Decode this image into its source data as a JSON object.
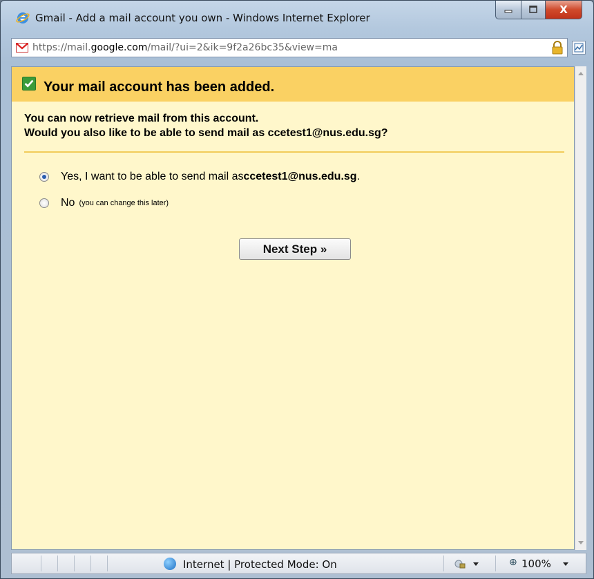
{
  "window": {
    "title": "Gmail - Add a mail account you own - Windows Internet Explorer",
    "controls": {
      "close_label": "X"
    }
  },
  "addressbar": {
    "url_prefix": "https://mail.",
    "url_domain": "google.com",
    "url_path": "/mail/?ui=2&ik=9f2a26bc35&view=ma"
  },
  "banner": {
    "title": "Your mail account has been added."
  },
  "info": {
    "line1": "You can now retrieve mail from this account.",
    "line2": "Would you also like to be able to send mail as ccetest1@nus.edu.sg?"
  },
  "options": {
    "yes_prefix": "Yes, I want to be able to send mail as ",
    "yes_email": "ccetest1@nus.edu.sg",
    "yes_suffix": ".",
    "yes_selected": true,
    "no_label": "No",
    "no_hint": "(you can change this later)"
  },
  "buttons": {
    "next": "Next Step »"
  },
  "statusbar": {
    "zone": "Internet | Protected Mode: On",
    "zoom": "100%"
  },
  "colors": {
    "banner": "#fad163",
    "panel": "#fff7cb",
    "divider": "#f2cc5a"
  },
  "icons": [
    "ie-icon",
    "gmail-icon",
    "lock-icon",
    "compat-view-icon",
    "check-icon",
    "globe-icon",
    "security-icon",
    "zoom-icon"
  ]
}
